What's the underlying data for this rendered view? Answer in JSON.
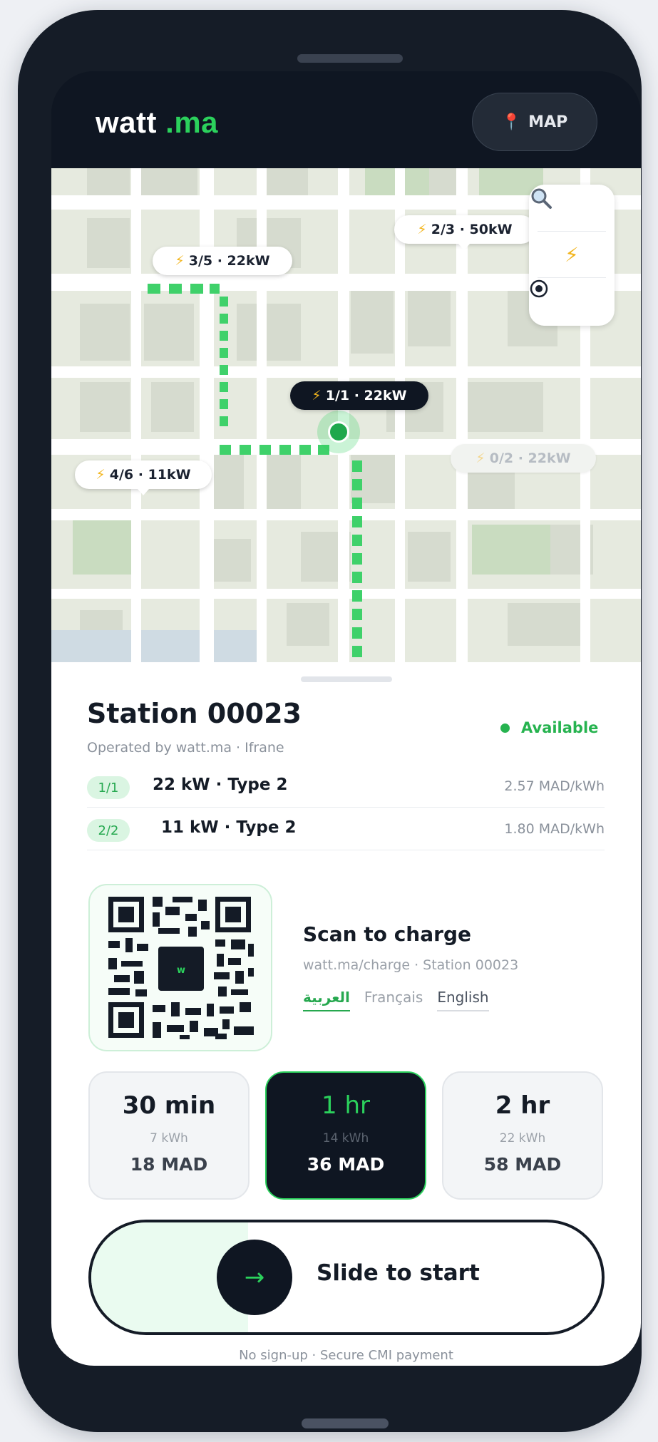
{
  "app": {
    "logo_name": "watt",
    "logo_tld": ".ma",
    "map_button_label": "MAP"
  },
  "map": {
    "labels": [
      {
        "text": "3/5 · 22kW",
        "state": "normal"
      },
      {
        "text": "2/3 · 50kW",
        "state": "normal"
      },
      {
        "text": "1/1 · 22kW",
        "state": "selected"
      },
      {
        "text": "0/2 · 22kW",
        "state": "muted"
      },
      {
        "text": "4/6 · 11kW",
        "state": "normal"
      }
    ],
    "tools": [
      "search-icon",
      "bolt-icon",
      "locate-icon"
    ],
    "route_color": "#3fd16a"
  },
  "station": {
    "title": "Station 00023",
    "operated": "Operated by watt.ma · Ifrane",
    "status": "Available",
    "connectors": [
      {
        "badge": "1/1",
        "spec": "22 kW · Type 2",
        "price": "2.57 MAD/kWh"
      },
      {
        "badge": "2/2",
        "spec": "11 kW · Type 2",
        "price": "1.80 MAD/kWh"
      }
    ]
  },
  "scan": {
    "qr_center": "w",
    "title": "Scan to charge",
    "url": "watt.ma/charge · Station 00023",
    "languages": [
      "العربية",
      "Français",
      "English"
    ]
  },
  "durations": [
    {
      "time": "30 min",
      "kwh": "7 kWh",
      "price": "18 MAD",
      "selected": false
    },
    {
      "time": "1 hr",
      "kwh": "14 kWh",
      "price": "36 MAD",
      "selected": true
    },
    {
      "time": "2 hr",
      "kwh": "22 kWh",
      "price": "58 MAD",
      "selected": false
    }
  ],
  "slider": {
    "label": "Slide to start",
    "arrow": "→"
  },
  "footnote": "No sign-up · Secure CMI payment",
  "colors": {
    "accent": "#2bd15c",
    "dark": "#0f1622",
    "map_bg": "#e6eadf"
  }
}
